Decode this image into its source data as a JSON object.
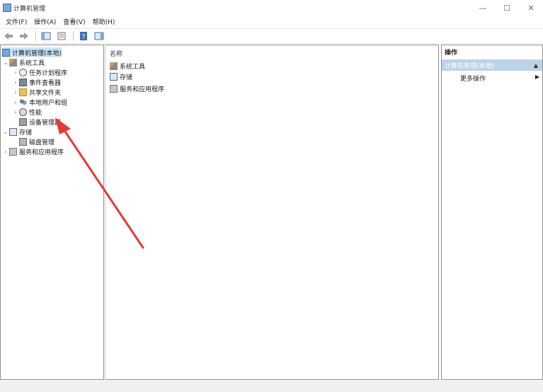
{
  "window": {
    "title": "计算机管理",
    "minimize": "—",
    "maximize": "☐",
    "close": "✕"
  },
  "menu": [
    "文件(F)",
    "操作(A)",
    "查看(V)",
    "帮助(H)"
  ],
  "tree": {
    "root": "计算机管理(本地)",
    "system_tools": "系统工具",
    "task_scheduler": "任务计划程序",
    "event_viewer": "事件查看器",
    "shared_folders": "共享文件夹",
    "local_users": "本地用户和组",
    "performance": "性能",
    "device_manager": "设备管理器",
    "storage": "存储",
    "disk_management": "磁盘管理",
    "services_apps": "服务和应用程序"
  },
  "center": {
    "column_header": "名称",
    "items": [
      "系统工具",
      "存储",
      "服务和应用程序"
    ]
  },
  "actions": {
    "header": "操作",
    "section": "计算机管理(本地)",
    "more": "更多操作"
  },
  "colors": {
    "annotation_arrow": "#e03a3a",
    "selection": "#cce4f7",
    "action_section": "#bcd3e8"
  }
}
